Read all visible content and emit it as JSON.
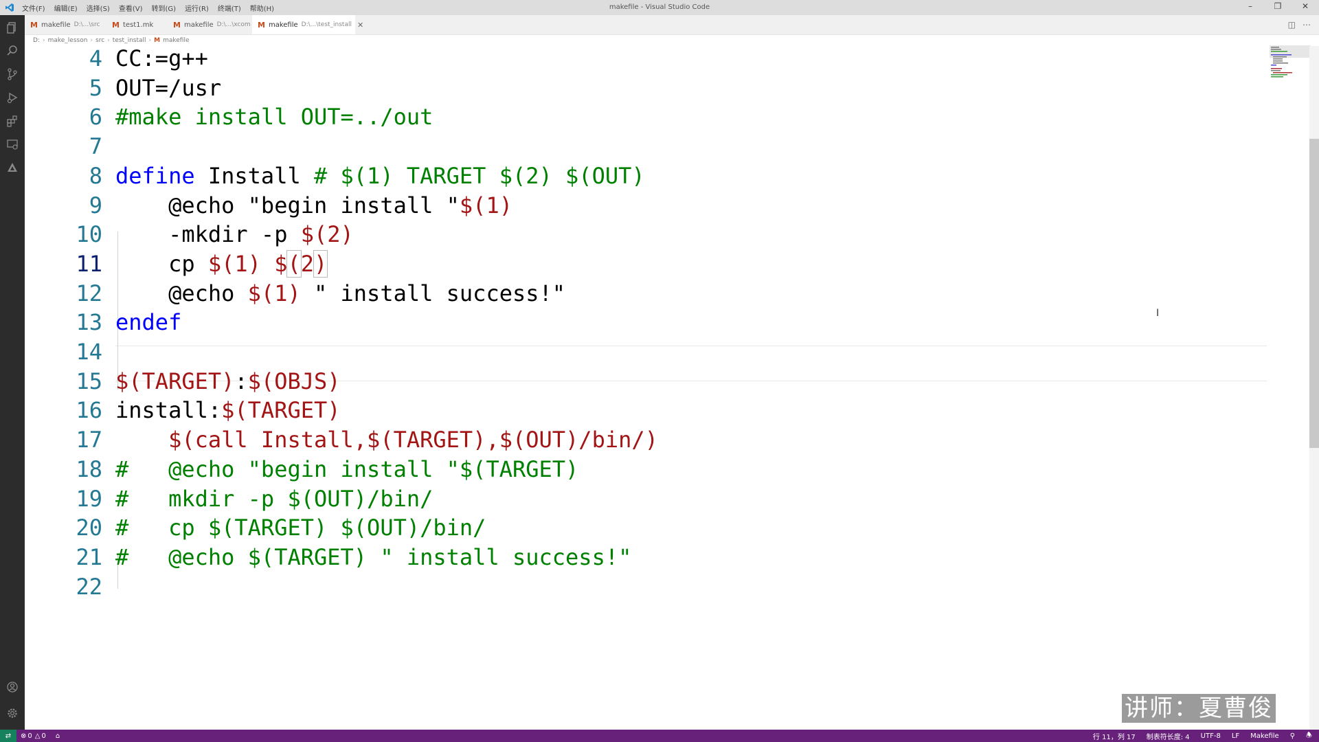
{
  "window": {
    "title": "makefile - Visual Studio Code"
  },
  "menu": [
    "文件(F)",
    "编辑(E)",
    "选择(S)",
    "查看(V)",
    "转到(G)",
    "运行(R)",
    "终端(T)",
    "帮助(H)"
  ],
  "tabs": [
    {
      "name": "makefile",
      "path": "D:\\...\\src"
    },
    {
      "name": "test1.mk",
      "path": ""
    },
    {
      "name": "makefile",
      "path": "D:\\...\\xcom"
    },
    {
      "name": "makefile",
      "path": "D:\\...\\test_install",
      "active": true
    }
  ],
  "breadcrumb": [
    "D:",
    "make_lesson",
    "src",
    "test_install",
    "makefile"
  ],
  "editor": {
    "current_line": 11,
    "lines": [
      {
        "num": "4",
        "parts": [
          {
            "t": "CC:=g++",
            "c": "plain"
          }
        ]
      },
      {
        "num": "5",
        "parts": [
          {
            "t": "OUT=/usr",
            "c": "plain"
          }
        ]
      },
      {
        "num": "6",
        "parts": [
          {
            "t": "#make install OUT=../out",
            "c": "cm"
          }
        ]
      },
      {
        "num": "7",
        "parts": []
      },
      {
        "num": "8",
        "parts": [
          {
            "t": "define",
            "c": "kw"
          },
          {
            "t": " Install ",
            "c": "plain"
          },
          {
            "t": "# $(1) TARGET $(2) $(OUT)",
            "c": "cm"
          }
        ]
      },
      {
        "num": "9",
        "parts": [
          {
            "t": "    @echo \"begin install \"",
            "c": "plain"
          },
          {
            "t": "$(1)",
            "c": "var"
          }
        ]
      },
      {
        "num": "10",
        "parts": [
          {
            "t": "    -mkdir -p ",
            "c": "plain"
          },
          {
            "t": "$(2)",
            "c": "var"
          }
        ]
      },
      {
        "num": "11",
        "parts": [
          {
            "t": "    cp ",
            "c": "plain"
          },
          {
            "t": "$(1)",
            "c": "var"
          },
          {
            "t": " ",
            "c": "plain"
          },
          {
            "t": "$",
            "c": "var"
          },
          {
            "t": "(",
            "c": "var bracket"
          },
          {
            "t": "2",
            "c": "var"
          },
          {
            "t": ")",
            "c": "var bracket"
          }
        ]
      },
      {
        "num": "12",
        "parts": [
          {
            "t": "    @echo ",
            "c": "plain"
          },
          {
            "t": "$(1)",
            "c": "var"
          },
          {
            "t": " \" install success!\"",
            "c": "plain"
          }
        ]
      },
      {
        "num": "13",
        "parts": [
          {
            "t": "endef",
            "c": "kw"
          }
        ]
      },
      {
        "num": "14",
        "parts": []
      },
      {
        "num": "15",
        "parts": [
          {
            "t": "$(TARGET)",
            "c": "var"
          },
          {
            "t": ":",
            "c": "plain"
          },
          {
            "t": "$(OBJS)",
            "c": "var"
          }
        ]
      },
      {
        "num": "16",
        "parts": [
          {
            "t": "install:",
            "c": "plain"
          },
          {
            "t": "$(TARGET)",
            "c": "var"
          }
        ]
      },
      {
        "num": "17",
        "parts": [
          {
            "t": "    $(call Install,$(TARGET),$(OUT)/bin/)",
            "c": "var"
          }
        ]
      },
      {
        "num": "18",
        "parts": [
          {
            "t": "#   @echo \"begin install \"$(TARGET)",
            "c": "cm"
          }
        ]
      },
      {
        "num": "19",
        "parts": [
          {
            "t": "#   mkdir -p $(OUT)/bin/",
            "c": "cm"
          }
        ]
      },
      {
        "num": "20",
        "parts": [
          {
            "t": "#   cp $(TARGET) $(OUT)/bin/",
            "c": "cm"
          }
        ]
      },
      {
        "num": "21",
        "parts": [
          {
            "t": "#   @echo $(TARGET) \" install success!\"",
            "c": "cm"
          }
        ]
      },
      {
        "num": "22",
        "parts": []
      }
    ]
  },
  "watermark": "讲师：夏曹俊",
  "status": {
    "errors": "0",
    "warnings": "0",
    "position": "行 11，列 17",
    "tab_size": "制表符长度: 4",
    "encoding": "UTF-8",
    "eol": "LF",
    "language": "Makefile"
  },
  "colors": {
    "statusbar": "#68217a",
    "keyword": "#0000ff",
    "variable": "#a31515",
    "comment": "#008000",
    "line_number": "#237893"
  }
}
